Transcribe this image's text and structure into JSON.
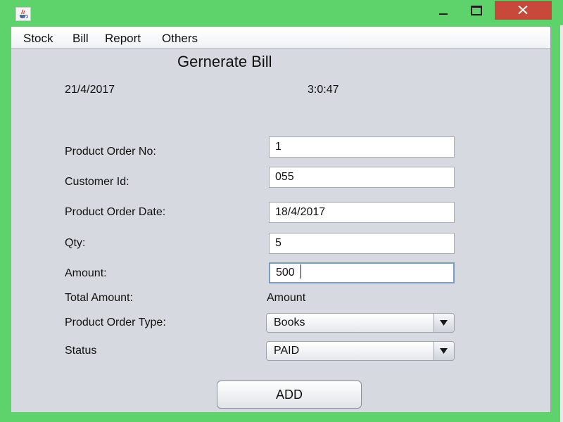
{
  "window": {
    "title": ""
  },
  "menu": {
    "items": [
      "Stock",
      "Bill",
      "Report",
      "Others"
    ]
  },
  "form": {
    "title": "Gernerate Bill",
    "date": "21/4/2017",
    "time": "3:0:47",
    "fields": [
      {
        "label": "Product Order No:",
        "value": "1"
      },
      {
        "label": "Customer Id:",
        "value": "055"
      },
      {
        "label": "Product Order Date:",
        "value": "18/4/2017"
      },
      {
        "label": "Qty:",
        "value": "5"
      },
      {
        "label": "Amount:",
        "value": "500"
      }
    ],
    "total_amount": {
      "label": "Total Amount:",
      "value": "Amount"
    },
    "order_type": {
      "label": "Product Order Type:",
      "selected": "Books"
    },
    "status": {
      "label": "Status",
      "selected": "PAID"
    },
    "add_button": "ADD"
  },
  "icons": {
    "app": "java-cup-icon",
    "minimize": "minimize-icon",
    "maximize": "maximize-icon",
    "close": "close-icon",
    "dropdown": "chevron-down-icon"
  },
  "colors": {
    "window_frame": "#5fd36b",
    "close_button": "#c9483c",
    "panel_background": "#d6d9df"
  }
}
